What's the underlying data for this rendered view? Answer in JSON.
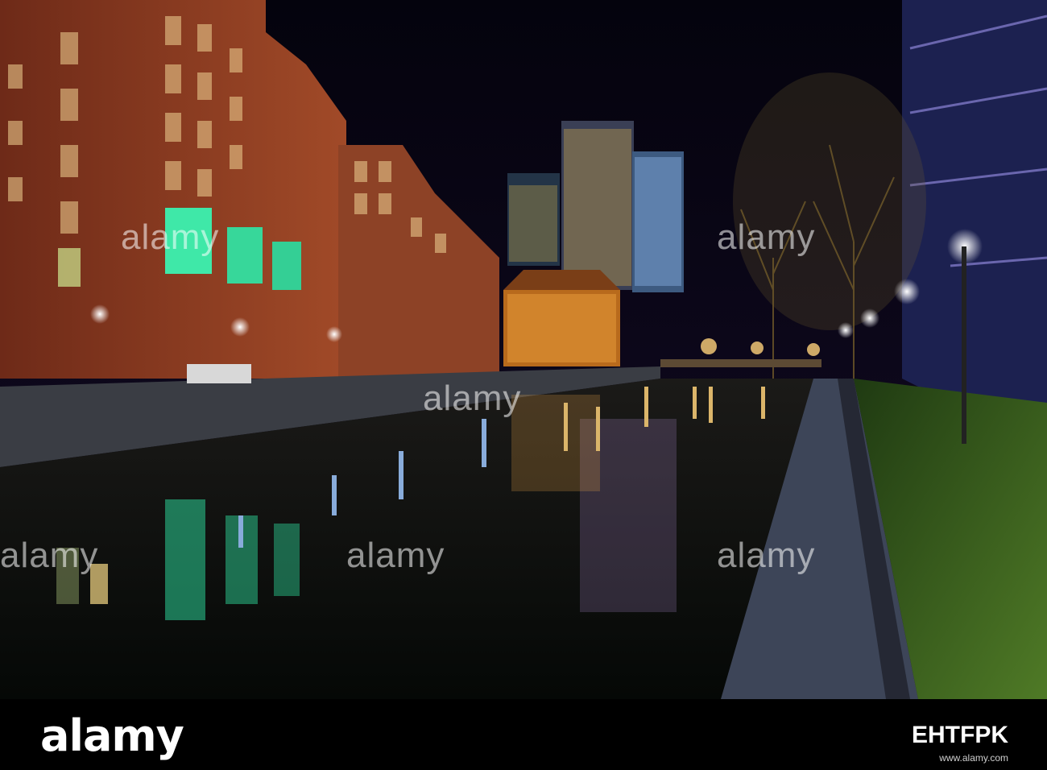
{
  "photo": {
    "description_icon": "night-canal-scene"
  },
  "watermarks": [
    "alamy",
    "alamy",
    "alamy",
    "alamy",
    "alamy",
    "alamy"
  ],
  "footer": {
    "logo": "alamy",
    "image_id": "EHTFPK",
    "site": "www.alamy.com"
  },
  "colors": {
    "sky": "#06040f",
    "water": "#0b1410",
    "footer_bg": "#000000",
    "brick": "#8a3b22",
    "green_glass": "#2fe0a0",
    "warm_light": "#ffb84a",
    "cool_light": "#7fb4ff"
  }
}
